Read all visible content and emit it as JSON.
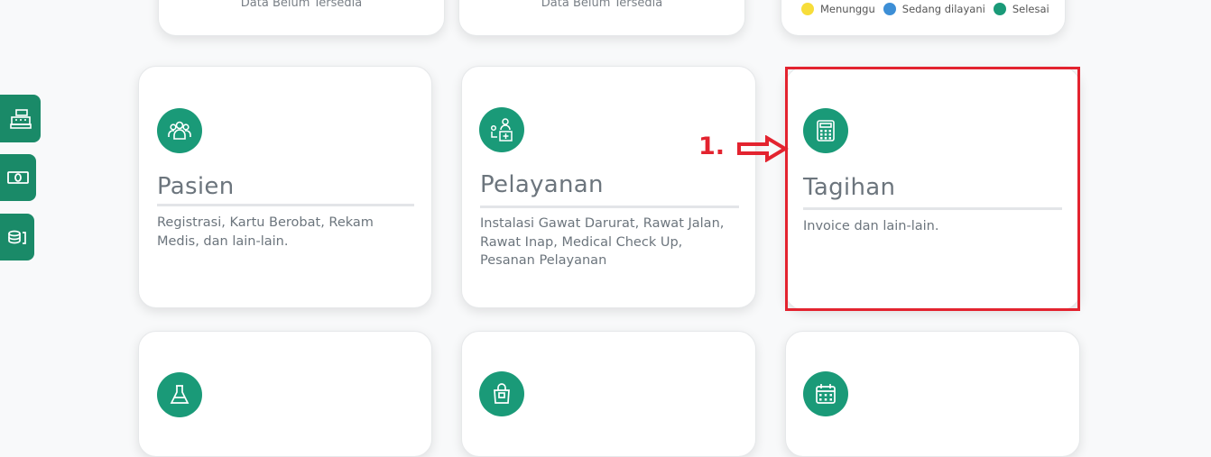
{
  "top_cards": [
    {
      "text": "Data Belum Tersedia"
    },
    {
      "text": "Data Belum Tersedia"
    }
  ],
  "legend": [
    {
      "label": "Menunggu",
      "color": "#f7dd3a"
    },
    {
      "label": "Sedang dilayani",
      "color": "#3d8fd6"
    },
    {
      "label": "Selesai",
      "color": "#1a9a78"
    }
  ],
  "menu_cards": [
    {
      "title": "Pasien",
      "description": "Registrasi, Kartu Berobat, Rekam Medis, dan lain-lain.",
      "icon": "users-icon"
    },
    {
      "title": "Pelayanan",
      "description": "Instalasi Gawat Darurat, Rawat Jalan, Rawat Inap, Medical Check Up, Pesanan Pelayanan",
      "icon": "doctor-service-icon"
    },
    {
      "title": "Tagihan",
      "description": "Invoice dan lain-lain.",
      "icon": "calculator-icon"
    }
  ],
  "bottom_cards": [
    {
      "icon": "flask-icon"
    },
    {
      "icon": "shopping-bag-icon"
    },
    {
      "icon": "calendar-icon"
    }
  ],
  "side_buttons": [
    {
      "icon": "cash-register-icon"
    },
    {
      "icon": "money-bill-icon"
    },
    {
      "icon": "coins-icon"
    }
  ],
  "annotation": {
    "number": "1."
  },
  "colors": {
    "accent": "#1a9a78",
    "highlight": "#e3232f"
  }
}
